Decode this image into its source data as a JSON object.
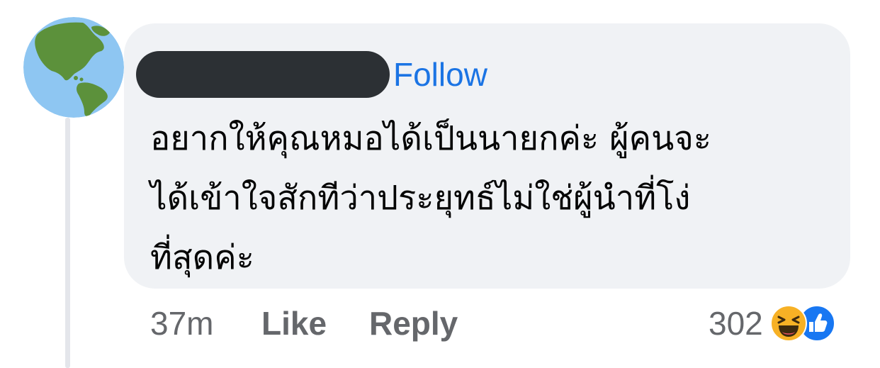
{
  "comment": {
    "follow_label": "Follow",
    "text": "อยากให้คุณหมอได้เป็นนายกค่ะ ผู้คนจะ\nได้เข้าใจสักทีว่าประยุทธ์ไม่ใช่ผู้นำที่โง่\nที่สุดค่ะ",
    "timestamp": "37m",
    "like_label": "Like",
    "reply_label": "Reply",
    "reaction_count": "302",
    "reactions": [
      "haha-icon",
      "like-icon"
    ]
  },
  "colors": {
    "bubble": "#f0f2f5",
    "link_blue": "#1b74e4",
    "meta_gray": "#65676b",
    "text": "#050505",
    "redaction": "#2c3034"
  },
  "avatar": {
    "icon": "globe-americas-icon"
  }
}
